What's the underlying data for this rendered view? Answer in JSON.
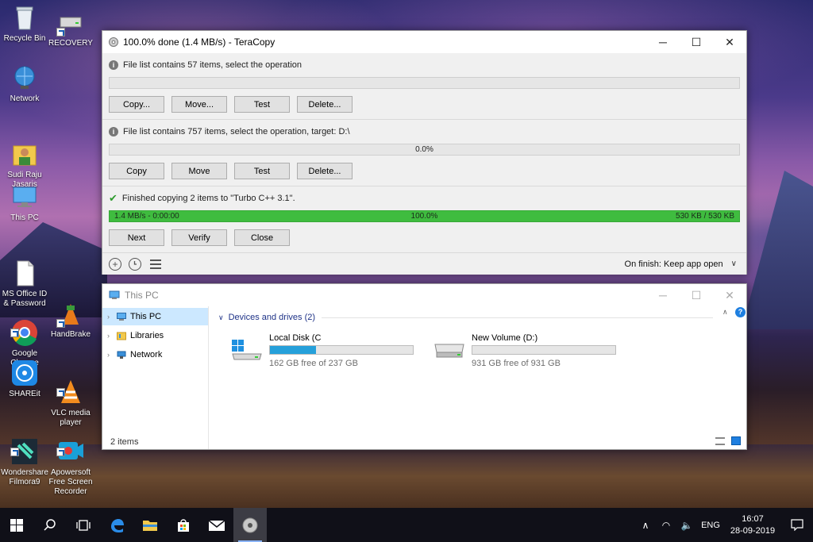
{
  "desktop": {
    "icons": [
      {
        "label": "Recycle Bin",
        "icon": "recycle-bin-icon"
      },
      {
        "label": "RECOVERY",
        "icon": "drive-icon"
      },
      {
        "label": "Network",
        "icon": "network-icon"
      },
      {
        "label": "Sudi Raju\nJasaris",
        "icon": "user-folder-icon"
      },
      {
        "label": "This PC",
        "icon": "computer-icon"
      },
      {
        "label": "MS Office ID\n& Password",
        "icon": "document-icon"
      },
      {
        "label": "Google\nChrome",
        "icon": "chrome-icon"
      },
      {
        "label": "HandBrake",
        "icon": "handbrake-icon"
      },
      {
        "label": "SHAREit",
        "icon": "shareit-icon"
      },
      {
        "label": "VLC media\nplayer",
        "icon": "vlc-icon"
      },
      {
        "label": "Wondershare\nFilmora9",
        "icon": "filmora-icon"
      },
      {
        "label": "Apowersoft\nFree Screen\nRecorder",
        "icon": "recorder-icon"
      }
    ]
  },
  "teracopy": {
    "title": "100.0% done (1.4 MB/s) - TeraCopy",
    "section1": {
      "status": "File list contains 57 items, select the operation",
      "buttons": [
        "Copy...",
        "Move...",
        "Test",
        "Delete..."
      ]
    },
    "section2": {
      "status": "File list contains 757 items, select the operation, target: D:\\",
      "progress_text": "0.0%",
      "progress": 0,
      "buttons": [
        "Copy",
        "Move",
        "Test",
        "Delete..."
      ]
    },
    "section3": {
      "status": "Finished copying 2 items to \"Turbo C++ 3.1\".",
      "speed": "1.4 MB/s - 0:00:00",
      "progress_text": "100.0%",
      "progress": 100,
      "size": "530 KB / 530 KB",
      "buttons": [
        "Next",
        "Verify",
        "Close"
      ]
    },
    "footer": {
      "on_finish": "On finish: Keep app open"
    }
  },
  "explorer": {
    "title": "This PC",
    "nav": [
      {
        "label": "This PC",
        "selected": true
      },
      {
        "label": "Libraries",
        "selected": false
      },
      {
        "label": "Network",
        "selected": false
      }
    ],
    "group_header": "Devices and drives (2)",
    "drives": [
      {
        "name": "Local Disk (C",
        "free": "162 GB free of 237 GB",
        "used_fraction": 0.32
      },
      {
        "name": "New Volume (D:)",
        "free": "931 GB free of 931 GB",
        "used_fraction": 0.0
      }
    ],
    "status": "2 items"
  },
  "taskbar": {
    "language": "ENG",
    "time": "16:07",
    "date": "28-09-2019"
  },
  "colors": {
    "progress_green": "#3fbc3f",
    "drive_blue": "#26a0da",
    "selection": "#cce8ff"
  }
}
